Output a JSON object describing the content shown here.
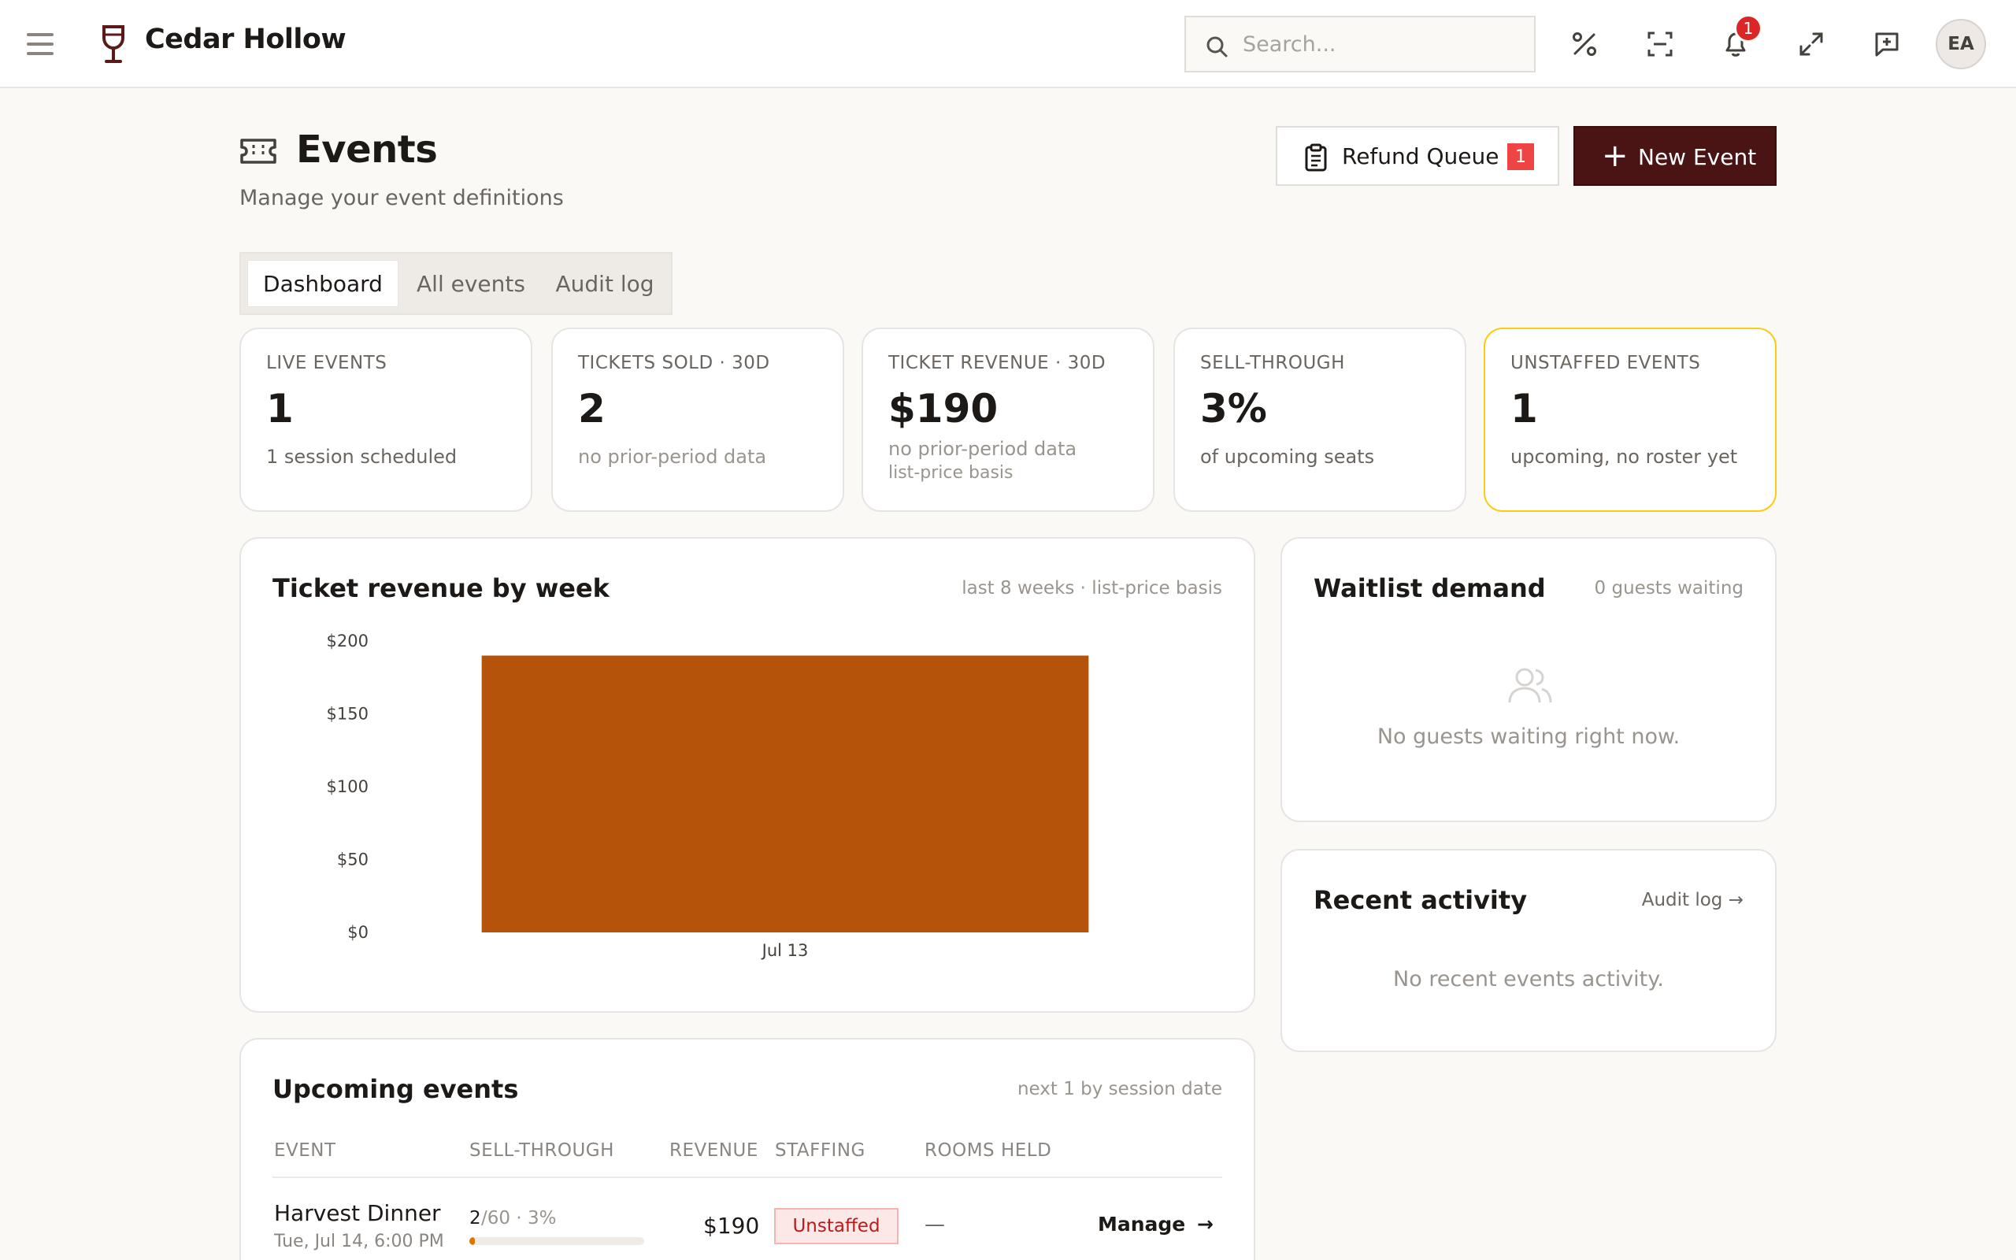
{
  "app": {
    "name": "Cedar Hollow"
  },
  "header": {
    "search_placeholder": "Search...",
    "notifications_count": "1",
    "avatar_initials": "EA"
  },
  "page": {
    "title": "Events",
    "subtitle": "Manage your event definitions",
    "refund_queue": {
      "label": "Refund Queue",
      "count": "1"
    },
    "new_event_label": "New Event"
  },
  "tabs": [
    {
      "label": "Dashboard",
      "active": true
    },
    {
      "label": "All events",
      "active": false
    },
    {
      "label": "Audit log",
      "active": false
    }
  ],
  "stats": [
    {
      "label": "LIVE EVENTS",
      "value": "1",
      "note": "1 session scheduled"
    },
    {
      "label": "TICKETS SOLD · 30D",
      "value": "2",
      "note": "no prior-period data"
    },
    {
      "label": "TICKET REVENUE · 30D",
      "value": "$190",
      "note": "no prior-period data",
      "note2": "list-price basis"
    },
    {
      "label": "SELL-THROUGH",
      "value": "3%",
      "note": "of upcoming seats"
    },
    {
      "label": "UNSTAFFED EVENTS",
      "value": "1",
      "note": "upcoming, no roster yet"
    }
  ],
  "revenue_panel": {
    "title": "Ticket revenue by week",
    "meta": "last 8 weeks · list-price basis"
  },
  "chart_data": {
    "type": "bar",
    "categories": [
      "Jul 13"
    ],
    "values": [
      190
    ],
    "yticks": [
      "$200",
      "$150",
      "$100",
      "$50",
      "$0"
    ],
    "ylim": [
      0,
      200
    ],
    "color": "#b45309",
    "title": "Ticket revenue by week",
    "xlabel": "",
    "ylabel": ""
  },
  "waitlist_panel": {
    "title": "Waitlist demand",
    "meta": "0 guests waiting",
    "empty": "No guests waiting right now."
  },
  "activity_panel": {
    "title": "Recent activity",
    "link": "Audit log →",
    "empty": "No recent events activity."
  },
  "upcoming_panel": {
    "title": "Upcoming events",
    "meta": "next 1 by session date",
    "columns": [
      "EVENT",
      "SELL-THROUGH",
      "REVENUE",
      "STAFFING",
      "ROOMS HELD"
    ],
    "rows": [
      {
        "name": "Harvest Dinner",
        "date": "Tue, Jul 14, 6:00 PM",
        "sold": "2",
        "capacity_text": "/60 · 3%",
        "sell_through_fraction": 0.033,
        "revenue": "$190",
        "staffing": "Unstaffed",
        "rooms_held": "—",
        "action": "Manage"
      }
    ]
  },
  "colors": {
    "brand_dark": "#4a1414",
    "accent_bar": "#b45309",
    "warning_border": "#facc15",
    "danger": "#ef4444"
  }
}
